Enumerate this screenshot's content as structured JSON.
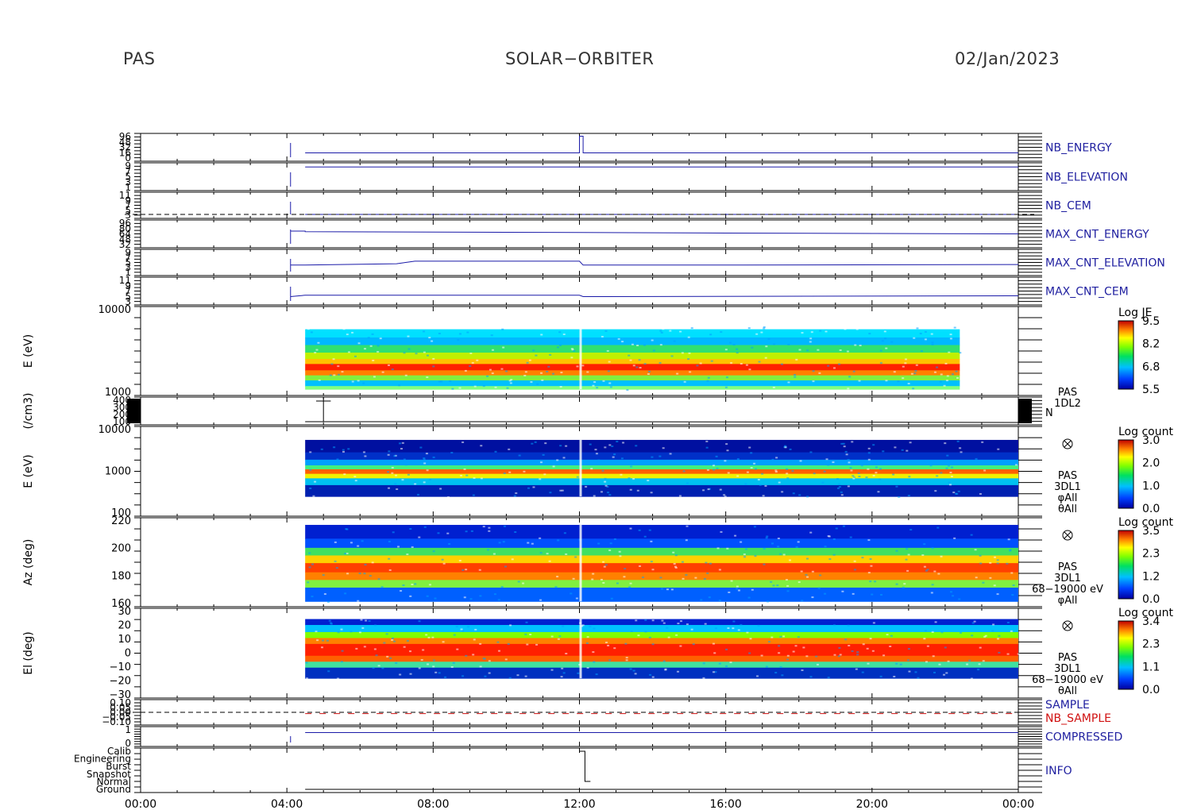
{
  "header": {
    "left": "PAS",
    "center": "SOLAR−ORBITER",
    "right": "02/Jan/2023"
  },
  "colors": {
    "series_blue": "#1a1aa8",
    "label_blue": "#2020a0",
    "label_red": "#d01010",
    "axis": "#000000"
  },
  "chart_data": {
    "type": "line",
    "x_ticks": [
      "00:00",
      "04:00",
      "08:00",
      "12:00",
      "16:00",
      "20:00",
      "00:00"
    ],
    "x_range_hours": [
      0,
      24
    ],
    "panels": [
      {
        "key": "nb_energy",
        "kind": "line",
        "label": "NB_ENERGY",
        "label_color": "blue",
        "yticks": [
          "96",
          "48",
          "32",
          "16",
          "0"
        ],
        "points": [
          [
            4.5,
            0.7
          ],
          [
            6.0,
            0.7
          ],
          [
            12.0,
            0.7
          ],
          [
            12.0,
            0.1
          ],
          [
            12.1,
            0.1
          ],
          [
            12.1,
            0.7
          ],
          [
            18.0,
            0.7
          ],
          [
            24.0,
            0.7
          ]
        ]
      },
      {
        "key": "nb_elevation",
        "kind": "line",
        "label": "NB_ELEVATION",
        "label_color": "blue",
        "yticks": [
          "9",
          "7",
          "5",
          "3",
          "1"
        ],
        "points": [
          [
            4.5,
            0.15
          ],
          [
            24.0,
            0.15
          ]
        ]
      },
      {
        "key": "nb_cem",
        "kind": "line",
        "label": "NB_CEM",
        "label_color": "blue",
        "yticks": [
          "11",
          "9",
          "7",
          "5",
          "3"
        ],
        "points": [
          [
            4.5,
            0.85
          ],
          [
            24.0,
            0.85
          ]
        ]
      },
      {
        "key": "max_cnt_energy",
        "kind": "line",
        "label": "MAX_CNT_ENERGY",
        "label_color": "blue",
        "yticks": [
          "96",
          "80",
          "64",
          "48",
          "32"
        ],
        "points": [
          [
            4.1,
            0.4
          ],
          [
            4.5,
            0.4
          ],
          [
            4.5,
            0.42
          ],
          [
            12.0,
            0.45
          ],
          [
            16.0,
            0.47
          ],
          [
            24.0,
            0.5
          ]
        ]
      },
      {
        "key": "max_cnt_elevation",
        "kind": "line",
        "label": "MAX_CNT_ELEVATION",
        "label_color": "blue",
        "yticks": [
          "9",
          "7",
          "5",
          "3",
          "1"
        ],
        "points": [
          [
            4.1,
            0.6
          ],
          [
            4.5,
            0.6
          ],
          [
            7.0,
            0.55
          ],
          [
            7.5,
            0.45
          ],
          [
            12.0,
            0.45
          ],
          [
            12.1,
            0.6
          ],
          [
            16.5,
            0.6
          ],
          [
            24.0,
            0.58
          ]
        ]
      },
      {
        "key": "max_cnt_cem",
        "kind": "line",
        "label": "MAX_CNT_CEM",
        "label_color": "blue",
        "yticks": [
          "11",
          "9",
          "7",
          "5",
          "3"
        ],
        "points": [
          [
            4.1,
            0.7
          ],
          [
            4.5,
            0.65
          ],
          [
            12.0,
            0.65
          ],
          [
            12.1,
            0.7
          ],
          [
            24.0,
            0.67
          ]
        ]
      },
      {
        "key": "je_spectrogram",
        "kind": "spectrogram",
        "ylabel": "E (eV)",
        "yticks": [
          "10000",
          "1000"
        ],
        "x_start": 4.5,
        "x_end": 22.4,
        "colorbar": {
          "title": "Log JE",
          "ticks": [
            "9.5",
            "8.2",
            "6.8",
            "5.5"
          ]
        }
      },
      {
        "key": "density",
        "kind": "density",
        "ylabel": "(/cm3)",
        "yticks": [
          "400",
          "300",
          "200",
          "100"
        ],
        "side_label": [
          "PAS",
          "1DL2"
        ],
        "side_letter": "N"
      },
      {
        "key": "counts_energy",
        "kind": "spectrogram",
        "ylabel": "E (eV)",
        "yticks": [
          "10000",
          "1000",
          "100"
        ],
        "x_start": 4.5,
        "x_end": 24.0,
        "side_label": [
          "PAS",
          "3DL1",
          "φAll",
          "θAll"
        ],
        "colorbar": {
          "title": "Log count",
          "ticks": [
            "3.0",
            "2.0",
            "1.0",
            "0.0"
          ]
        }
      },
      {
        "key": "azimuth",
        "kind": "spectrogram",
        "ylabel": "Az (deg)",
        "yticks": [
          "220",
          "200",
          "180",
          "160"
        ],
        "x_start": 4.5,
        "x_end": 24.0,
        "side_label": [
          "PAS",
          "3DL1",
          "68−19000 eV",
          "φAll"
        ],
        "colorbar": {
          "title": "Log count",
          "ticks": [
            "3.5",
            "2.3",
            "1.2",
            "0.0"
          ]
        }
      },
      {
        "key": "elevation",
        "kind": "spectrogram",
        "ylabel": "El (deg)",
        "yticks": [
          "30",
          "20",
          "10",
          "0",
          "−10",
          "−20",
          "−30"
        ],
        "x_start": 4.5,
        "x_end": 24.0,
        "side_label": [
          "PAS",
          "3DL1",
          "68−19000 eV",
          "θAll"
        ],
        "colorbar": {
          "title": "Log count",
          "ticks": [
            "3.4",
            "2.3",
            "1.1",
            "0.0"
          ]
        }
      },
      {
        "key": "sample",
        "kind": "sample",
        "labels": [
          "SAMPLE",
          "NB_SAMPLE"
        ],
        "yticks": [
          "0.10",
          "0.05",
          "0.00",
          "−0.05",
          "−0.10"
        ]
      },
      {
        "key": "compressed",
        "kind": "line",
        "label": "COMPRESSED",
        "label_color": "blue",
        "yticks": [
          "1",
          "0"
        ],
        "points": [
          [
            4.5,
            0.3
          ],
          [
            24.0,
            0.3
          ]
        ]
      },
      {
        "key": "info",
        "kind": "info",
        "label": "INFO",
        "yticks": [
          "Calib",
          "Engineering",
          "Burst",
          "Snapshot",
          "Normal",
          "Ground"
        ]
      }
    ]
  }
}
